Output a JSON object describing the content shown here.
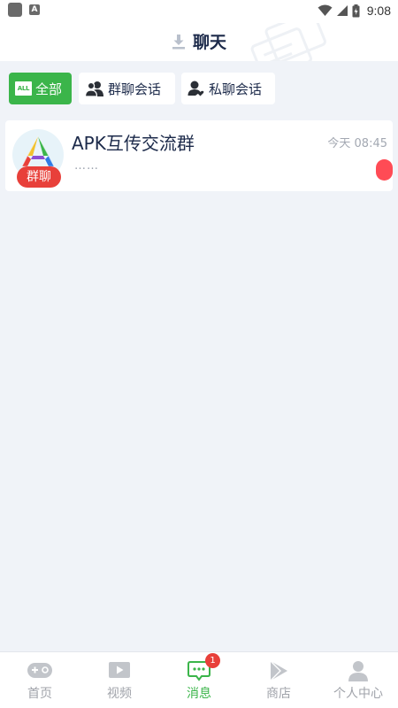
{
  "status_bar": {
    "time": "9:08",
    "icons": [
      "app-icon",
      "a-icon",
      "wifi-icon",
      "signal-icon",
      "battery-icon"
    ]
  },
  "header": {
    "title": "聊天",
    "icons": [
      "download-icon"
    ]
  },
  "filters": [
    {
      "label": "全部",
      "icon": "all-badge-icon",
      "badge_text": "ALL",
      "active": true
    },
    {
      "label": "群聊会话",
      "icon": "group-users-icon",
      "active": false
    },
    {
      "label": "私聊会话",
      "icon": "single-user-icon",
      "active": false
    }
  ],
  "chats": [
    {
      "name": "APK互传交流群",
      "preview": "……",
      "time": "今天 08:45",
      "badge": "群聊",
      "avatar_icon": "apk-logo-icon",
      "unread": true
    }
  ],
  "tabbar": {
    "tabs": [
      {
        "label": "首页",
        "icon": "gamepad-icon",
        "active": false
      },
      {
        "label": "视频",
        "icon": "video-play-icon",
        "active": false
      },
      {
        "label": "消息",
        "icon": "message-icon",
        "active": true,
        "badge": "1"
      },
      {
        "label": "商店",
        "icon": "store-play-icon",
        "active": false
      },
      {
        "label": "个人中心",
        "icon": "person-icon",
        "active": false
      }
    ]
  },
  "colors": {
    "accent": "#3bb54a",
    "badge_red": "#e8403a",
    "unread_dot": "#ff4b55",
    "background": "#f0f3f8",
    "title_text": "#1c2a4a"
  }
}
